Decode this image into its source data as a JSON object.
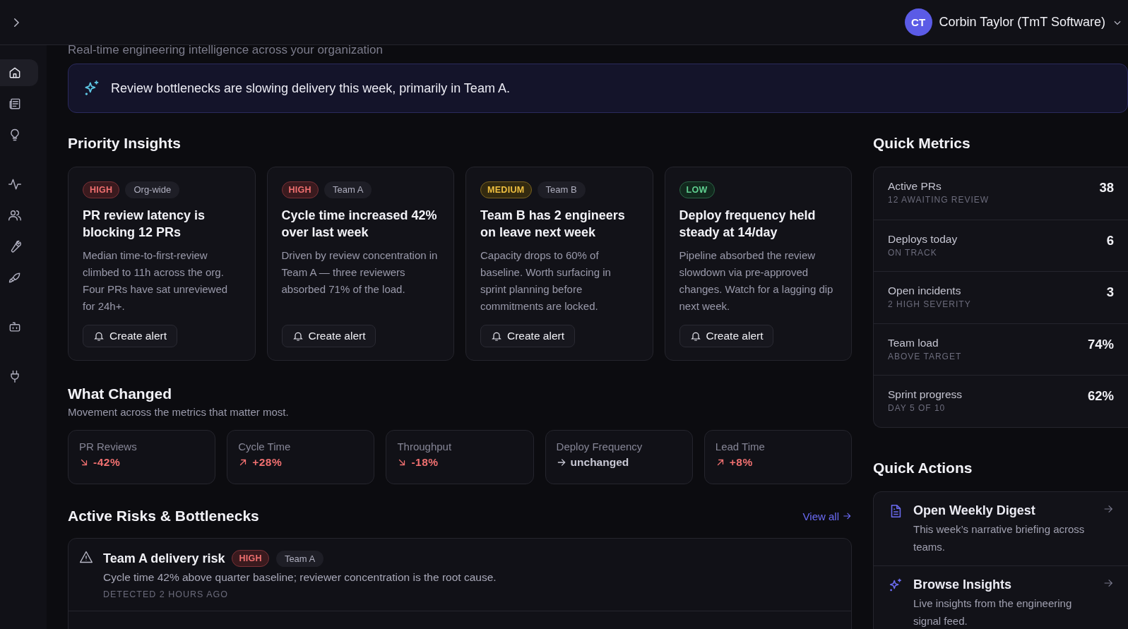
{
  "header": {
    "avatar_initials": "CT",
    "user_name": "Corbin Taylor (TmT Software)"
  },
  "sidebar": {
    "items": [
      {
        "selected": true
      },
      {
        "selected": false
      },
      {
        "selected": false
      },
      {
        "selected": false
      },
      {
        "selected": false
      },
      {
        "selected": false
      },
      {
        "selected": false
      },
      {
        "selected": false
      },
      {
        "selected": false
      }
    ]
  },
  "subtitle": "Real-time engineering intelligence across your organization",
  "banner": {
    "text": "Review bottlenecks are slowing delivery this week, primarily in Team A."
  },
  "priority_insights": {
    "title": "Priority Insights",
    "cards": [
      {
        "severity": "HIGH",
        "kind": "high",
        "scope": "Org-wide",
        "title": "PR review latency is blocking 12 PRs",
        "body": "Median time-to-first-review climbed to 11h across the org. Four PRs have sat unreviewed for 24h+.",
        "action": "Create alert"
      },
      {
        "severity": "HIGH",
        "kind": "high",
        "scope": "Team A",
        "title": "Cycle time increased 42% over last week",
        "body": "Driven by review concentration in Team A — three reviewers absorbed 71% of the load.",
        "action": "Create alert"
      },
      {
        "severity": "MEDIUM",
        "kind": "medium",
        "scope": "Team B",
        "title": "Team B has 2 engineers on leave next week",
        "body": "Capacity drops to 60% of baseline. Worth surfacing in sprint planning before commitments are locked.",
        "action": "Create alert"
      },
      {
        "severity": "LOW",
        "kind": "low",
        "title": "Deploy frequency held steady at 14/day",
        "body": "Pipeline absorbed the review slowdown via pre-approved changes. Watch for a lagging dip next week.",
        "action": "Create alert"
      }
    ]
  },
  "what_changed": {
    "title": "What Changed",
    "subtitle": "Movement across the metrics that matter most.",
    "tiles": [
      {
        "label": "PR Reviews",
        "kind": "down",
        "change": "-42%"
      },
      {
        "label": "Cycle Time",
        "kind": "up",
        "change": "+28%"
      },
      {
        "label": "Throughput",
        "kind": "down",
        "change": "-18%"
      },
      {
        "label": "Deploy Frequency",
        "kind": "flat",
        "change": "unchanged"
      },
      {
        "label": "Lead Time",
        "kind": "up",
        "change": "+8%"
      }
    ]
  },
  "risks": {
    "title": "Active Risks & Bottlenecks",
    "view_all": "View all",
    "items": [
      {
        "title": "Team A delivery risk",
        "severity": "HIGH",
        "kind": "high",
        "scope": "Team A",
        "body": "Cycle time 42% above quarter baseline; reviewer concentration is the root cause.",
        "detected": "DETECTED 2 HOURS AGO"
      }
    ]
  },
  "quick_metrics": {
    "title": "Quick Metrics",
    "rows": [
      {
        "label": "Active PRs",
        "note": "12 AWAITING REVIEW",
        "value": "38"
      },
      {
        "label": "Deploys today",
        "note": "ON TRACK",
        "value": "6"
      },
      {
        "label": "Open incidents",
        "note": "2 HIGH SEVERITY",
        "value": "3"
      },
      {
        "label": "Team load",
        "note": "ABOVE TARGET",
        "value": "74%"
      },
      {
        "label": "Sprint progress",
        "note": "DAY 5 OF 10",
        "value": "62%"
      }
    ]
  },
  "quick_actions": {
    "title": "Quick Actions",
    "items": [
      {
        "title": "Open Weekly Digest",
        "body": "This week’s narrative briefing across teams."
      },
      {
        "title": "Browse Insights",
        "body": "Live insights from the engineering signal feed."
      }
    ]
  }
}
